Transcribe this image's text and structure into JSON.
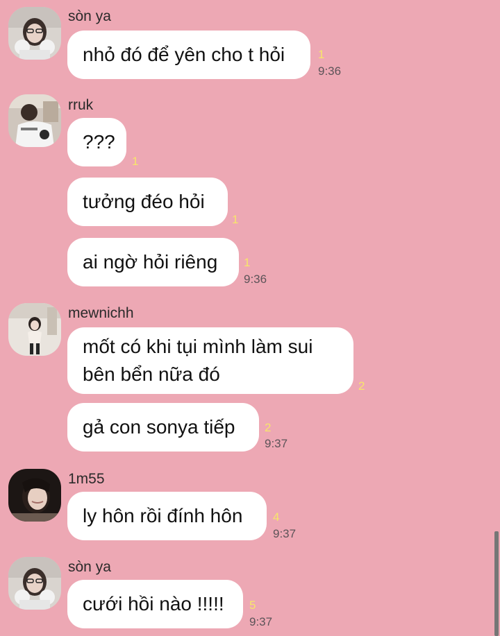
{
  "colors": {
    "background": "#eda8b4",
    "bubble": "#ffffff",
    "unread_count": "#f7e66a",
    "time": "#5c5358"
  },
  "messages": [
    {
      "sender": "sòn ya",
      "avatar": "avatar-son-ya",
      "text": "nhỏ đó để yên cho t hỏi",
      "unread": "1",
      "time": "9:36"
    },
    {
      "sender": "rruk",
      "avatar": "avatar-rruk",
      "text": "???",
      "unread": "1"
    },
    {
      "text": "tưởng đéo hỏi",
      "unread": "1"
    },
    {
      "text": "ai ngờ hỏi riêng",
      "unread": "1",
      "time": "9:36"
    },
    {
      "sender": "mewnichh",
      "avatar": "avatar-mewnichh",
      "lines": [
        "mốt có khi tụi mình làm sui",
        "bên bển nữa đó"
      ],
      "unread": "2"
    },
    {
      "text": "gả con sonya tiếp",
      "unread": "2",
      "time": "9:37"
    },
    {
      "sender": "1m55",
      "avatar": "avatar-1m55",
      "text": "ly hôn rồi đính hôn",
      "unread": "4",
      "time": "9:37"
    },
    {
      "sender": "sòn ya",
      "avatar": "avatar-son-ya",
      "text": "cưới hồi nào !!!!!",
      "unread": "5",
      "time": "9:37"
    }
  ]
}
